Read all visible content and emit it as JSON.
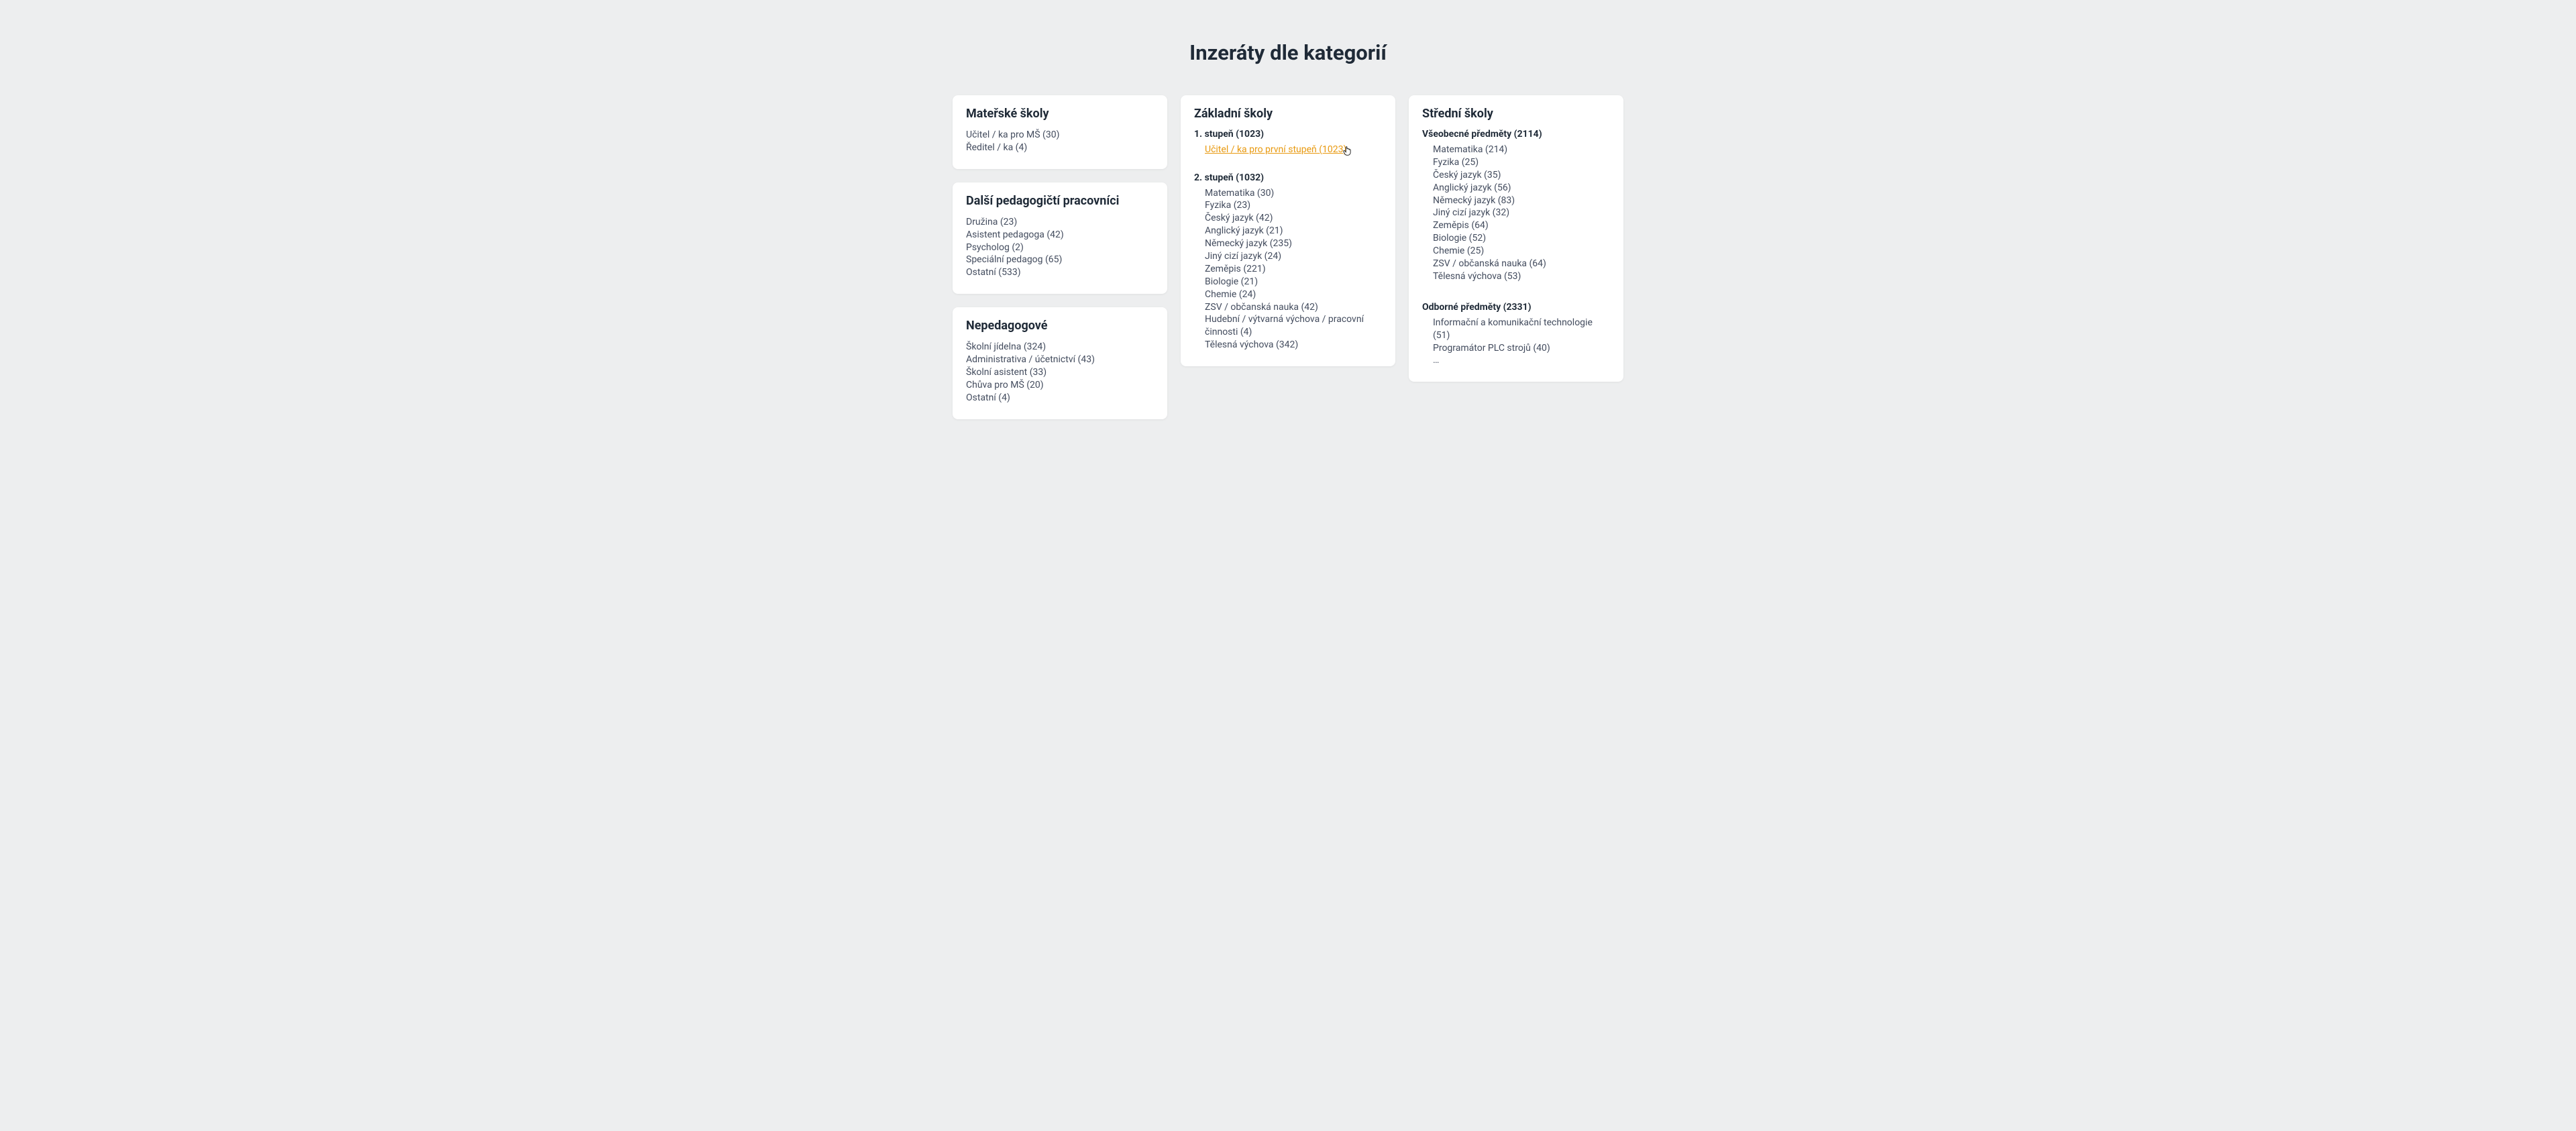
{
  "page_title": "Inzeráty dle kategorií",
  "col1": {
    "card1": {
      "title": "Mateřské školy",
      "items": [
        "Učitel / ka pro MŠ (30)",
        "Ředitel / ka (4)"
      ]
    },
    "card2": {
      "title": "Další pedagogičtí pracovníci",
      "items": [
        "Družina (23)",
        "Asistent pedagoga (42)",
        "Psycholog (2)",
        "Speciální pedagog (65)",
        "Ostatní (533)"
      ]
    },
    "card3": {
      "title": "Nepedagogové",
      "items": [
        "Školní jídelna (324)",
        "Administrativa / účetnictví (43)",
        "Školní asistent (33)",
        "Chůva pro MŠ (20)",
        "Ostatní (4)"
      ]
    }
  },
  "col2": {
    "card1": {
      "title": "Základní školy",
      "section1_title": "1. stupeň (1023)",
      "section1_items": [
        "Učitel / ka pro první stupeň (1023)"
      ],
      "section2_title": "2. stupeň (1032)",
      "section2_items": [
        "Matematika (30)",
        "Fyzika (23)",
        "Český jazyk (42)",
        "Anglický jazyk (21)",
        "Německý jazyk (235)",
        "Jiný cizí jazyk (24)",
        "Zeměpis (221)",
        "Biologie (21)",
        "Chemie (24)",
        "ZSV / občanská nauka (42)",
        "Hudební / výtvarná výchova / pracovní činnosti (4)",
        "Tělesná výchova (342)"
      ]
    }
  },
  "col3": {
    "card1": {
      "title": "Střední školy",
      "section1_title": "Všeobecné předměty (2114)",
      "section1_items": [
        "Matematika (214)",
        "Fyzika (25)",
        "Český jazyk (35)",
        "Anglický jazyk (56)",
        "Německý jazyk (83)",
        "Jiný cizí jazyk (32)",
        "Zeměpis (64)",
        "Biologie (52)",
        "Chemie (25)",
        "ZSV / občanská nauka (64)",
        "Tělesná výchova (53)"
      ],
      "section2_title": "Odborné předměty (2331)",
      "section2_items": [
        "Informační a komunikační technologie (51)",
        "Programátor PLC strojů (40)",
        "…"
      ]
    }
  }
}
